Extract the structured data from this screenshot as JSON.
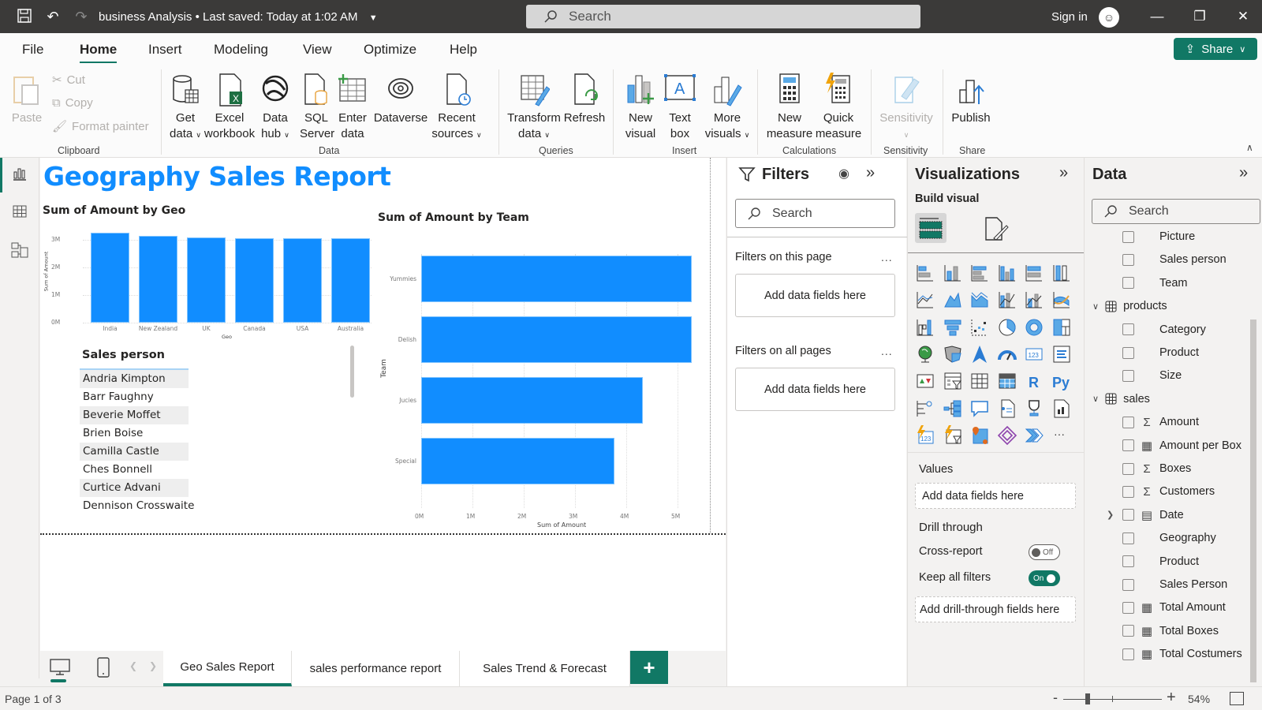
{
  "titlebar": {
    "doc_title": "business Analysis",
    "separator": "•",
    "last_saved": "Last saved: Today at 1:02 AM",
    "search_placeholder": "Search",
    "sign_in": "Sign in"
  },
  "menu": {
    "items": [
      "File",
      "Home",
      "Insert",
      "Modeling",
      "View",
      "Optimize",
      "Help"
    ],
    "active": "Home",
    "share_label": "Share"
  },
  "ribbon": {
    "clipboard": {
      "paste": "Paste",
      "cut": "Cut",
      "copy": "Copy",
      "format_painter": "Format painter",
      "group": "Clipboard"
    },
    "data": {
      "get_data": [
        "Get",
        "data"
      ],
      "excel": [
        "Excel",
        "workbook"
      ],
      "data_hub": [
        "Data",
        "hub"
      ],
      "sql": [
        "SQL",
        "Server"
      ],
      "enter_data": [
        "Enter",
        "data"
      ],
      "dataverse": [
        "Dataverse",
        ""
      ],
      "recent": [
        "Recent",
        "sources"
      ],
      "group": "Data"
    },
    "queries": {
      "transform": [
        "Transform",
        "data"
      ],
      "refresh": [
        "Refresh",
        ""
      ],
      "group": "Queries"
    },
    "insert": {
      "new_visual": [
        "New",
        "visual"
      ],
      "text_box": [
        "Text",
        "box"
      ],
      "more_visuals": [
        "More",
        "visuals"
      ],
      "group": "Insert"
    },
    "calculations": {
      "new_measure": [
        "New",
        "measure"
      ],
      "quick_measure": [
        "Quick",
        "measure"
      ],
      "group": "Calculations"
    },
    "sensitivity": {
      "label": "Sensitivity",
      "group": "Sensitivity"
    },
    "share": {
      "publish": "Publish",
      "group": "Share"
    }
  },
  "report": {
    "title": "Geography Sales Report",
    "table": {
      "header": "Sales person",
      "rows": [
        "Andria Kimpton",
        "Barr Faughny",
        "Beverie Moffet",
        "Brien Boise",
        "Camilla Castle",
        "Ches Bonnell",
        "Curtice Advani",
        "Dennison Crosswaite"
      ]
    }
  },
  "chart_data": [
    {
      "type": "bar",
      "orientation": "vertical",
      "title": "Sum of Amount by Geo",
      "xlabel": "Geo",
      "ylabel": "Sum of Amount",
      "categories": [
        "India",
        "New Zealand",
        "UK",
        "Canada",
        "USA",
        "Australia"
      ],
      "values": [
        3260000,
        3140000,
        3080000,
        3070000,
        3070000,
        3050000
      ],
      "yticks": [
        "0M",
        "1M",
        "2M",
        "3M"
      ],
      "ylim": [
        0,
        3300000
      ],
      "grid": true,
      "color": "#118dff"
    },
    {
      "type": "bar",
      "orientation": "horizontal",
      "title": "Sum of Amount by Team",
      "xlabel": "Sum of Amount",
      "ylabel": "Team",
      "categories": [
        "Yummies",
        "Delish",
        "Jucies",
        "Special"
      ],
      "values": [
        5280000,
        5280000,
        4320000,
        3770000
      ],
      "xticks": [
        "0M",
        "1M",
        "2M",
        "3M",
        "4M",
        "5M"
      ],
      "xlim": [
        0,
        5280000
      ],
      "grid": true,
      "color": "#118dff"
    }
  ],
  "pages": {
    "tabs": [
      "Geo Sales Report",
      "sales performance report",
      "Sales Trend & Forecast"
    ],
    "active": "Geo Sales Report",
    "add_label": "+"
  },
  "status": {
    "page": "Page 1 of 3",
    "zoom_minus": "-",
    "zoom_plus": "+",
    "zoom": "54%",
    "zoom_percent": 54
  },
  "filters": {
    "title": "Filters",
    "search_placeholder": "Search",
    "on_page": "Filters on this page",
    "on_all": "Filters on all pages",
    "add_fields": "Add data fields here",
    "more": "..."
  },
  "visualizations": {
    "title": "Visualizations",
    "build_visual": "Build visual",
    "values_label": "Values",
    "values_placeholder": "Add data fields here",
    "drill_through": "Drill through",
    "cross_report": "Cross-report",
    "cross_report_state": "Off",
    "keep_filters": "Keep all filters",
    "keep_filters_state": "On",
    "drill_placeholder": "Add drill-through fields here",
    "icons": [
      "stacked-bar-icon",
      "stacked-column-icon",
      "clustered-bar-icon",
      "clustered-column-icon",
      "100-stacked-bar-icon",
      "100-stacked-column-icon",
      "line-chart-icon",
      "area-chart-icon",
      "stacked-area-icon",
      "line-column-icon",
      "line-clustered-column-icon",
      "ribbon-chart-icon",
      "waterfall-icon",
      "funnel-icon",
      "scatter-icon",
      "pie-icon",
      "donut-icon",
      "treemap-icon",
      "map-icon",
      "filled-map-icon",
      "azure-map-icon",
      "gauge-icon",
      "card-icon",
      "multi-row-card-icon",
      "kpi-icon",
      "slicer-icon",
      "table-icon",
      "matrix-icon",
      "r-visual-icon",
      "python-visual-icon",
      "key-influencers-icon",
      "decomposition-tree-icon",
      "qa-icon",
      "smart-narrative-icon",
      "goals-icon",
      "paginated-report-icon",
      "power-apps-icon",
      "power-automate-icon",
      "arcgis-icon",
      "power-apps-diamond-icon",
      "power-automate-chevron-icon",
      "more-visuals-icon"
    ]
  },
  "datapane": {
    "title": "Data",
    "search_placeholder": "Search",
    "items": [
      {
        "kind": "field",
        "name": "Picture",
        "type": ""
      },
      {
        "kind": "field",
        "name": "Sales person",
        "type": ""
      },
      {
        "kind": "field",
        "name": "Team",
        "type": ""
      },
      {
        "kind": "table",
        "name": "products"
      },
      {
        "kind": "field",
        "name": "Category",
        "type": ""
      },
      {
        "kind": "field",
        "name": "Product",
        "type": ""
      },
      {
        "kind": "field",
        "name": "Size",
        "type": ""
      },
      {
        "kind": "table",
        "name": "sales"
      },
      {
        "kind": "field",
        "name": "Amount",
        "type": "sum"
      },
      {
        "kind": "field",
        "name": "Amount per Box",
        "type": "measure"
      },
      {
        "kind": "field",
        "name": "Boxes",
        "type": "sum"
      },
      {
        "kind": "field",
        "name": "Customers",
        "type": "sum"
      },
      {
        "kind": "field",
        "name": "Date",
        "type": "date"
      },
      {
        "kind": "field",
        "name": "Geography",
        "type": ""
      },
      {
        "kind": "field",
        "name": "Product",
        "type": ""
      },
      {
        "kind": "field",
        "name": "Sales Person",
        "type": ""
      },
      {
        "kind": "field",
        "name": "Total Amount",
        "type": "measure"
      },
      {
        "kind": "field",
        "name": "Total Boxes",
        "type": "measure"
      },
      {
        "kind": "field",
        "name": "Total Costumers",
        "type": "measure"
      }
    ]
  },
  "colors": {
    "accent": "#117865",
    "bar": "#118dff",
    "title_bar": "#3b3a39"
  }
}
